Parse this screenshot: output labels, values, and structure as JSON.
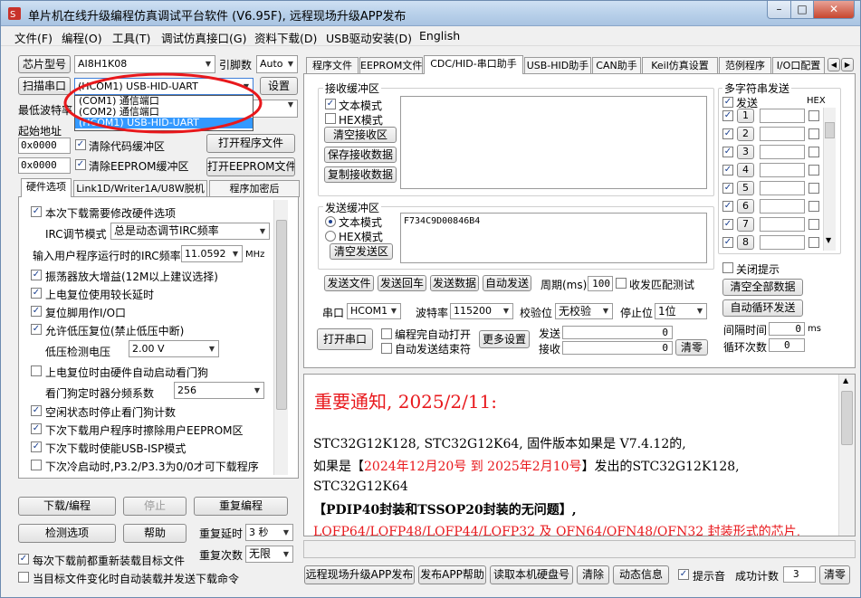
{
  "window": {
    "title": "单片机在线升级编程仿真调试平台软件 (V6.95F), 远程现场升级APP发布",
    "min": "–",
    "max": "□",
    "close": "✕"
  },
  "menu": [
    "文件(F)",
    "编程(O)",
    "工具(T)",
    "调试仿真接口(G)",
    "资料下载(D)",
    "USB驱动安装(D)",
    "English"
  ],
  "left": {
    "chip_btn": "芯片型号",
    "chip_value": "AI8H1K08",
    "pin_label": "引脚数",
    "pin_value": "Auto",
    "scan_btn": "扫描串口",
    "port_value": "(HCOM1) USB-HID-UART",
    "settings_btn": "设置",
    "baud_label": "最低波特率",
    "port_options": [
      "(COM1) 通信端口",
      "(COM2) 通信端口",
      "(HCOM1) USB-HID-UART"
    ],
    "start_addr_label": "起始地址",
    "addr1": "0x0000",
    "addr2": "0x0000",
    "clear_code": "清除代码缓冲区",
    "clear_eeprom": "清除EEPROM缓冲区",
    "open_prog": "打开程序文件",
    "open_eeprom": "打开EEPROM文件",
    "tabs": [
      "硬件选项",
      "Link1D/Writer1A/U8W脱机",
      "程序加密后"
    ],
    "opt_modify": "本次下载需要修改硬件选项",
    "irc_mode_label": "IRC调节模式",
    "irc_mode_value": "总是动态调节IRC频率",
    "irc_freq_label": "输入用户程序运行时的IRC频率",
    "irc_freq_value": "11.0592",
    "mhz": "MHz",
    "opts": [
      "振荡器放大增益(12M以上建议选择)",
      "上电复位使用较长延时",
      "复位脚用作I/O口",
      "允许低压复位(禁止低压中断)"
    ],
    "lvd_label": "低压检测电压",
    "lvd_value": "2.00 V",
    "wdt_opt": "上电复位时由硬件自动启动看门狗",
    "wdt_label": "看门狗定时器分频系数",
    "wdt_value": "256",
    "opts2": [
      "空闲状态时停止看门狗计数",
      "下次下载用户程序时擦除用户EEPROM区",
      "下次下载时使能USB-ISP模式",
      "下次冷启动时,P3.2/P3.3为0/0才可下载程序"
    ],
    "download_btn": "下载/编程",
    "stop_btn": "停止",
    "reprog_btn": "重复编程",
    "check_btn": "检测选项",
    "help_btn": "帮助",
    "rep_delay_label": "重复延时",
    "rep_delay_value": "3 秒",
    "rep_count_label": "重复次数",
    "rep_count_value": "无限",
    "reload_opt": "每次下载前都重新装载目标文件",
    "auto_opt": "当目标文件变化时自动装载并发送下载命令"
  },
  "right": {
    "tabs": [
      "程序文件",
      "EEPROM文件",
      "CDC/HID-串口助手",
      "USB-HID助手",
      "CAN助手",
      "Keil仿真设置",
      "范例程序",
      "I/O口配置"
    ],
    "recv_group": "接收缓冲区",
    "text_mode": "文本模式",
    "hex_mode": "HEX模式",
    "clear_recv": "清空接收区",
    "save_recv": "保存接收数据",
    "copy_recv": "复制接收数据",
    "send_group": "发送缓冲区",
    "send_text": "F734C9D00846B4",
    "clear_send": "清空发送区",
    "send_file": "发送文件",
    "send_return": "发送回车",
    "send_data": "发送数据",
    "auto_send": "自动发送",
    "period_label": "周期(ms)",
    "period_value": "100",
    "close_match": "收发匹配测试",
    "port_label": "串口",
    "port_value": "HCOM1",
    "baud_label": "波特率",
    "baud_value": "115200",
    "parity_label": "校验位",
    "parity_value": "无校验",
    "stop_label": "停止位",
    "stop_value": "1位",
    "open_port": "打开串口",
    "auto_open": "编程完自动打开",
    "auto_send_end": "自动发送结束符",
    "more_settings": "更多设置",
    "send_label": "发送",
    "recv_label": "接收",
    "send_count": "0",
    "recv_count": "0",
    "clear_count": "清零",
    "multi_group": "多字符串发送",
    "send_col": "发送",
    "hex_col": "HEX",
    "multi": [
      "1",
      "2",
      "3",
      "4",
      "5",
      "6",
      "7",
      "8"
    ],
    "close_tip": "关闭提示",
    "clear_all": "清空全部数据",
    "auto_loop": "自动循环发送",
    "interval_label": "间隔时间",
    "interval_value": "0",
    "ms": "ms",
    "loop_label": "循环次数",
    "loop_value": "0"
  },
  "notice": {
    "heading": "重要通知, 2025/2/11:",
    "l1": "STC32G12K128, STC32G12K64, 固件版本如果是 V7.4.12的,",
    "l2a": "如果是【",
    "l2b": "2024年12月20号 到 2025年2月10号",
    "l2c": "】发出的STC32G12K128,",
    "l3": "STC32G12K64",
    "l4": "【PDIP40封装和TSSOP20封装的无问题】,",
    "l5": "LQFP64/LQFP48/LQFP44/LQFP32 及 QFN64/QFN48/QFN32 封装形式的芯片,"
  },
  "bottom": {
    "remote_btn": "远程现场升级APP发布",
    "publish_help": "发布APP帮助",
    "read_disk": "读取本机硬盘号",
    "clear_btn": "清除",
    "dynamic": "动态信息",
    "beep": "提示音",
    "success_label": "成功计数",
    "success_value": "3",
    "clear_zero": "清零"
  },
  "colors": {
    "red": "#e8181c",
    "title_bg": "#b9d1ea",
    "highlight": "#3399ff"
  }
}
